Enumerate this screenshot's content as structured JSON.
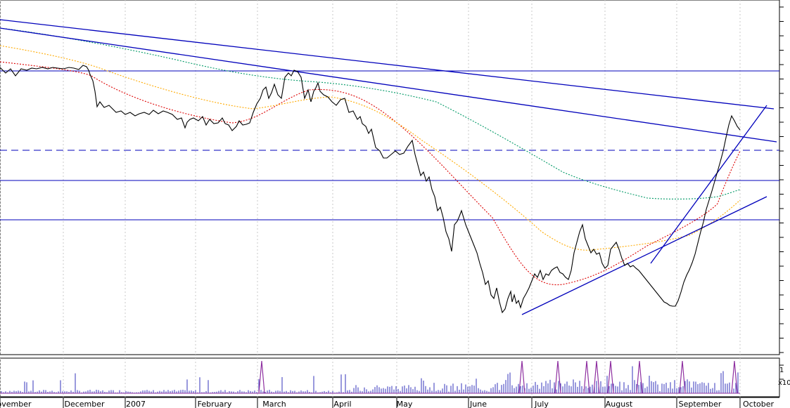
{
  "chart_data": {
    "type": "line",
    "title": "",
    "xlabel": "",
    "ylabel": "",
    "grid": true,
    "month_labels": [
      "ovember",
      "December",
      "2007",
      "February",
      "March",
      "April",
      "May",
      "June",
      "July",
      "August",
      "September",
      "October"
    ],
    "price_series": {
      "name": "",
      "color": "#000000",
      "x": [
        0,
        8,
        15,
        22,
        30,
        38,
        45,
        52,
        60,
        68,
        75,
        82,
        90,
        98,
        105,
        112,
        118,
        123,
        126,
        128,
        132,
        135,
        138,
        142,
        148,
        155,
        160,
        165,
        172,
        178,
        185,
        192,
        198,
        205,
        212,
        218,
        225,
        232,
        238,
        245,
        252,
        258,
        263,
        266,
        270,
        275,
        282,
        288,
        293,
        298,
        304,
        310,
        316,
        320,
        325,
        330,
        336,
        340,
        345,
        350,
        355,
        360,
        365,
        370,
        374,
        378,
        382,
        386,
        390,
        395,
        400,
        405,
        410,
        414,
        418,
        423,
        428,
        433,
        438,
        442,
        446,
        449,
        452,
        455,
        460,
        466,
        472,
        478,
        484,
        490,
        496,
        502,
        508,
        512,
        515,
        520,
        524,
        528,
        534,
        540,
        545,
        550,
        556,
        562,
        568,
        574,
        580,
        586,
        590,
        594,
        598,
        602,
        606,
        610,
        614,
        618,
        622,
        626,
        630,
        634,
        638,
        642,
        646,
        650,
        653,
        656,
        659,
        662,
        666,
        670,
        674,
        678,
        682,
        686,
        690,
        694,
        698,
        702,
        706,
        710,
        714,
        718,
        722,
        726,
        728,
        731,
        734,
        737,
        740,
        744,
        748,
        752,
        756,
        760,
        764,
        768,
        772,
        776,
        780,
        784,
        788,
        792,
        796,
        800,
        804,
        808,
        812,
        816,
        820,
        824,
        828,
        832,
        836,
        840,
        844,
        848,
        852,
        856,
        860,
        864,
        868,
        872,
        876,
        880,
        884,
        888,
        892,
        896,
        900,
        904,
        908,
        912,
        916,
        920,
        924,
        928,
        932,
        936,
        940,
        944,
        948,
        952,
        956,
        960,
        964,
        968,
        972,
        976,
        980,
        984,
        988,
        992,
        996,
        1000,
        1004,
        1008,
        1012,
        1016,
        1020,
        1024,
        1028,
        1032,
        1036,
        1040,
        1044,
        1048,
        1052
      ],
      "y": [
        96,
        104,
        98,
        108,
        98,
        100,
        97,
        98,
        96,
        98,
        96,
        97,
        98,
        96,
        97,
        99,
        93,
        95,
        100,
        106,
        115,
        130,
        152,
        145,
        153,
        150,
        155,
        160,
        158,
        163,
        160,
        165,
        162,
        160,
        163,
        157,
        162,
        158,
        160,
        163,
        170,
        168,
        182,
        174,
        170,
        168,
        172,
        166,
        178,
        170,
        176,
        175,
        168,
        176,
        178,
        186,
        180,
        172,
        178,
        177,
        175,
        160,
        148,
        140,
        128,
        124,
        140,
        132,
        120,
        135,
        140,
        110,
        104,
        108,
        100,
        102,
        110,
        140,
        128,
        145,
        130,
        125,
        118,
        130,
        135,
        138,
        145,
        150,
        142,
        140,
        160,
        158,
        170,
        166,
        176,
        180,
        190,
        184,
        210,
        215,
        225,
        225,
        220,
        215,
        220,
        218,
        208,
        200,
        220,
        235,
        250,
        245,
        258,
        252,
        270,
        280,
        300,
        295,
        310,
        330,
        340,
        358,
        320,
        315,
        308,
        300,
        310,
        320,
        330,
        340,
        350,
        360,
        375,
        388,
        405,
        400,
        420,
        425,
        410,
        430,
        445,
        440,
        425,
        415,
        430,
        420,
        432,
        428,
        438,
        425,
        418,
        410,
        400,
        390,
        395,
        385,
        398,
        390,
        392,
        385,
        382,
        380,
        388,
        390,
        395,
        398,
        385,
        360,
        345,
        330,
        320,
        340,
        350,
        360,
        355,
        362,
        360,
        375,
        382,
        378,
        355,
        350,
        345,
        355,
        368,
        378,
        375,
        380,
        378,
        382,
        385,
        390,
        395,
        400,
        405,
        410,
        415,
        420,
        425,
        430,
        432,
        435,
        436,
        436,
        428,
        416,
        402,
        392,
        384,
        374,
        362,
        346,
        330,
        316,
        298,
        285,
        272,
        258,
        244,
        230,
        215,
        196,
        178,
        165,
        172,
        180,
        185,
        194,
        195,
        188
      ],
      "note_on_y": "y values are read from the plot as relative vertical readings (no price axis labels visible)"
    },
    "ma_series": [
      {
        "name": "",
        "color": "#dd0000",
        "style": "dotted"
      },
      {
        "name": "",
        "color": "#ffaa00",
        "style": "dotted"
      },
      {
        "name": "",
        "color": "#009966",
        "style": "dotted"
      }
    ],
    "horizontal_levels": [
      {
        "style": "solid"
      },
      {
        "style": "dashed"
      },
      {
        "style": "solid"
      },
      {
        "style": "solid"
      }
    ],
    "trendlines": [
      {
        "type": "descending"
      },
      {
        "type": "descending"
      },
      {
        "type": "ascending"
      },
      {
        "type": "ascending"
      }
    ],
    "volume": {
      "note": "volume bars at bottom panel; values unlabeled",
      "y_axis_labels": [
        "1",
        "x10"
      ]
    }
  },
  "colors": {
    "price": "#000000",
    "trend": "#0000bb",
    "level": "#0000bb",
    "ma_red": "#dd0000",
    "ma_orange": "#ffaa00",
    "ma_green": "#009966",
    "volume_bar": "#3333bb",
    "volume_spike": "#8e2fa0",
    "grid": "#c8c8c8"
  }
}
